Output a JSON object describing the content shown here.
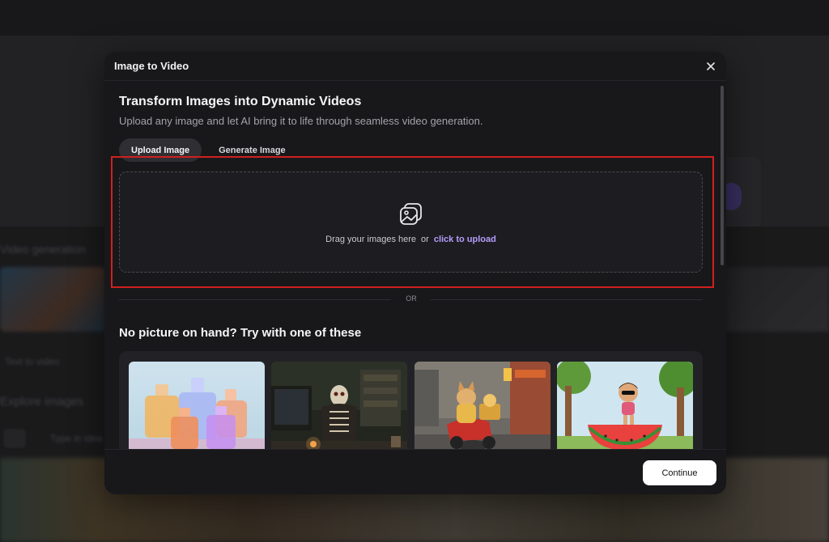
{
  "background": {
    "label_video": "Video generation",
    "label_text": "Text to video",
    "label_explore": "Explore images",
    "chip_text": "Type in idea"
  },
  "modal": {
    "title": "Image to Video",
    "heading": "Transform Images into Dynamic Videos",
    "subheading": "Upload any image and let AI bring it to life through seamless video generation.",
    "tabs": [
      {
        "label": "Upload Image",
        "active": true
      },
      {
        "label": "Generate Image",
        "active": false
      }
    ],
    "dropzone": {
      "text": "Drag your images here",
      "or": "or",
      "link": "click to upload",
      "icon": "image-upload-icon"
    },
    "divider": "OR",
    "samples_title": "No picture on hand? Try with one of these",
    "samples": [
      {
        "name": "perfume-bottles"
      },
      {
        "name": "skeleton-at-computer"
      },
      {
        "name": "cat-on-scooter"
      },
      {
        "name": "girl-on-watermelon"
      }
    ],
    "continue_label": "Continue"
  },
  "colors": {
    "accent_link": "#b39dfa",
    "highlight": "#d0201e",
    "modal_bg": "#18181b"
  }
}
